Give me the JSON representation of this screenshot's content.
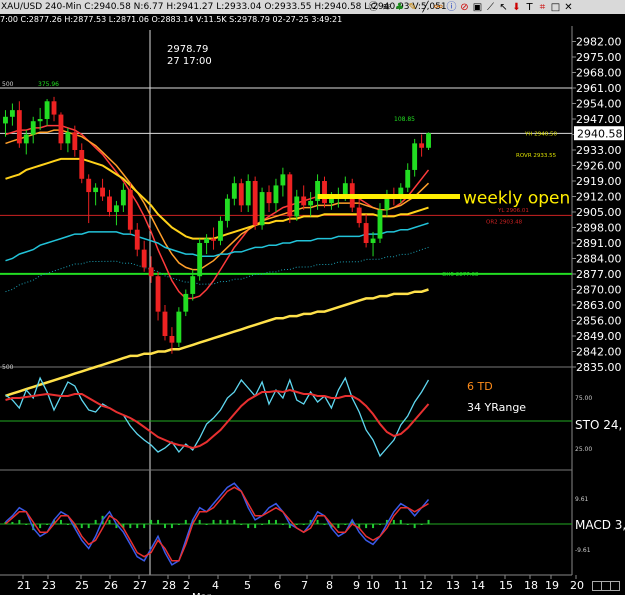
{
  "header": {
    "summary": "XAU/USD 240-Min C:2940.58 N:6.77 H:2941.27 L:2933.04 O:2933.55 H:2940.58 L:2940.93 V:5,051",
    "icons": [
      "c-icon",
      "wifi-icon",
      "tree-icon",
      "pencil-icon",
      "line-icon",
      "link-icon",
      "info-icon",
      "prohibit-icon",
      "lock-icon",
      "trend-icon",
      "pointer-icon",
      "arrow-down-icon",
      "t-icon",
      "chart-icon",
      "window-icon",
      "close-icon"
    ],
    "bar_info": "7:00 C:2877.26 H:2877.53 L:2871.06 O:2883.14 V:11.5K S:2978.79 02-27-25 3:49:21"
  },
  "crosshair_label": {
    "value": "2978.79",
    "time": "27 17:00"
  },
  "chart_data": [
    {
      "type": "candlestick",
      "panel": "price",
      "symbol": "XAU/USD",
      "interval": "240-Min",
      "ylim": [
        2835,
        2989
      ],
      "yticks": [
        "2982.00",
        "2975.00",
        "2968.00",
        "2961.00",
        "2954.00",
        "2947.00",
        "2940.00",
        "2933.00",
        "2926.00",
        "2919.00",
        "2912.00",
        "2905.00",
        "2898.00",
        "2891.00",
        "2884.00",
        "2877.00",
        "2870.00",
        "2863.00",
        "2856.00",
        "2849.00",
        "2842.00",
        "2835.00"
      ],
      "last_price": "2940.58",
      "left_labels": [
        "500",
        "500"
      ],
      "candles": [
        [
          2945,
          2951,
          2939,
          2948
        ],
        [
          2948,
          2954,
          2944,
          2951
        ],
        [
          2951,
          2955,
          2934,
          2936
        ],
        [
          2936,
          2942,
          2931,
          2940
        ],
        [
          2940,
          2948,
          2936,
          2946
        ],
        [
          2946,
          2952,
          2942,
          2947
        ],
        [
          2947,
          2956,
          2944,
          2955
        ],
        [
          2955,
          2957,
          2946,
          2949
        ],
        [
          2949,
          2950,
          2933,
          2936
        ],
        [
          2936,
          2943,
          2932,
          2941
        ],
        [
          2941,
          2944,
          2930,
          2933
        ],
        [
          2933,
          2936,
          2918,
          2920
        ],
        [
          2920,
          2922,
          2900,
          2914
        ],
        [
          2914,
          2918,
          2908,
          2916
        ],
        [
          2916,
          2920,
          2910,
          2912
        ],
        [
          2912,
          2915,
          2903,
          2905
        ],
        [
          2905,
          2910,
          2899,
          2908
        ],
        [
          2908,
          2918,
          2905,
          2915
        ],
        [
          2915,
          2918,
          2895,
          2897
        ],
        [
          2897,
          2900,
          2885,
          2888
        ],
        [
          2888,
          2892,
          2878,
          2880
        ],
        [
          2880,
          2885,
          2873,
          2876
        ],
        [
          2876,
          2878,
          2856,
          2860
        ],
        [
          2860,
          2863,
          2847,
          2849
        ],
        [
          2849,
          2853,
          2841,
          2846
        ],
        [
          2846,
          2862,
          2844,
          2860
        ],
        [
          2860,
          2870,
          2858,
          2868
        ],
        [
          2868,
          2879,
          2865,
          2876
        ],
        [
          2876,
          2893,
          2874,
          2891
        ],
        [
          2891,
          2895,
          2886,
          2893
        ],
        [
          2893,
          2898,
          2888,
          2892
        ],
        [
          2892,
          2903,
          2890,
          2901
        ],
        [
          2901,
          2913,
          2898,
          2911
        ],
        [
          2911,
          2921,
          2908,
          2918
        ],
        [
          2918,
          2920,
          2905,
          2908
        ],
        [
          2908,
          2922,
          2905,
          2919
        ],
        [
          2919,
          2921,
          2897,
          2899
        ],
        [
          2899,
          2916,
          2897,
          2914
        ],
        [
          2914,
          2917,
          2905,
          2909
        ],
        [
          2909,
          2920,
          2905,
          2917
        ],
        [
          2917,
          2925,
          2912,
          2922
        ],
        [
          2922,
          2923,
          2900,
          2903
        ],
        [
          2903,
          2915,
          2901,
          2912
        ],
        [
          2912,
          2917,
          2906,
          2908
        ],
        [
          2908,
          2914,
          2903,
          2910
        ],
        [
          2910,
          2922,
          2906,
          2919
        ],
        [
          2919,
          2921,
          2907,
          2909
        ],
        [
          2909,
          2914,
          2906,
          2911
        ],
        [
          2911,
          2916,
          2907,
          2913
        ],
        [
          2913,
          2921,
          2910,
          2918
        ],
        [
          2918,
          2920,
          2905,
          2907
        ],
        [
          2907,
          2911,
          2898,
          2900
        ],
        [
          2900,
          2904,
          2889,
          2891
        ],
        [
          2891,
          2896,
          2885,
          2893
        ],
        [
          2893,
          2909,
          2891,
          2906
        ],
        [
          2906,
          2915,
          2903,
          2913
        ],
        [
          2913,
          2916,
          2908,
          2911
        ],
        [
          2911,
          2918,
          2909,
          2916
        ],
        [
          2916,
          2927,
          2914,
          2924
        ],
        [
          2924,
          2938,
          2921,
          2936
        ],
        [
          2936,
          2940,
          2930,
          2934
        ],
        [
          2934,
          2941,
          2933,
          2940.58
        ]
      ],
      "moving_averages": [
        {
          "color": "#ff3b3b",
          "values": [
            2940,
            2941,
            2942,
            2942,
            2943,
            2943,
            2944,
            2944,
            2944,
            2943,
            2942,
            2940,
            2937,
            2934,
            2931,
            2927,
            2923,
            2919,
            2914,
            2909,
            2903,
            2896,
            2888,
            2881,
            2874,
            2869,
            2866,
            2866,
            2867,
            2870,
            2874,
            2879,
            2884,
            2889,
            2893,
            2897,
            2899,
            2901,
            2903,
            2905,
            2907,
            2908,
            2909,
            2910,
            2911,
            2912,
            2912,
            2912,
            2912,
            2913,
            2912,
            2911,
            2909,
            2907,
            2906,
            2906,
            2907,
            2909,
            2912,
            2916,
            2920,
            2924
          ]
        },
        {
          "color": "#ff9f2a",
          "values": [
            2936,
            2937,
            2938,
            2939,
            2940,
            2941,
            2941,
            2942,
            2942,
            2941,
            2940,
            2939,
            2937,
            2935,
            2932,
            2929,
            2926,
            2922,
            2918,
            2914,
            2909,
            2903,
            2897,
            2891,
            2886,
            2882,
            2880,
            2879,
            2879,
            2881,
            2883,
            2886,
            2889,
            2892,
            2895,
            2897,
            2899,
            2901,
            2902,
            2903,
            2904,
            2905,
            2906,
            2907,
            2907,
            2908,
            2908,
            2908,
            2909,
            2909,
            2909,
            2909,
            2908,
            2907,
            2906,
            2906,
            2907,
            2908,
            2910,
            2912,
            2915,
            2918
          ]
        },
        {
          "color": "#ffd21a",
          "values": [
            2920,
            2921,
            2922,
            2924,
            2925,
            2926,
            2927,
            2928,
            2929,
            2929,
            2929,
            2929,
            2928,
            2927,
            2926,
            2924,
            2922,
            2920,
            2917,
            2914,
            2911,
            2908,
            2904,
            2901,
            2898,
            2896,
            2894,
            2893,
            2893,
            2893,
            2893,
            2894,
            2895,
            2896,
            2897,
            2898,
            2899,
            2900,
            2900,
            2901,
            2901,
            2902,
            2902,
            2903,
            2903,
            2903,
            2904,
            2904,
            2904,
            2904,
            2904,
            2904,
            2904,
            2904,
            2903,
            2903,
            2903,
            2904,
            2904,
            2905,
            2906,
            2907
          ]
        },
        {
          "color": "#22c3d9",
          "values": [
            2883,
            2884,
            2886,
            2887,
            2888,
            2890,
            2891,
            2892,
            2893,
            2894,
            2895,
            2895,
            2896,
            2896,
            2896,
            2896,
            2896,
            2895,
            2895,
            2894,
            2893,
            2892,
            2891,
            2889,
            2888,
            2887,
            2886,
            2886,
            2885,
            2885,
            2885,
            2886,
            2886,
            2887,
            2887,
            2888,
            2889,
            2889,
            2890,
            2890,
            2891,
            2891,
            2892,
            2892,
            2892,
            2893,
            2893,
            2893,
            2894,
            2894,
            2894,
            2894,
            2895,
            2895,
            2895,
            2896,
            2896,
            2897,
            2897,
            2898,
            2899,
            2900
          ]
        },
        {
          "color": "#ffe14a",
          "values": [
            2822,
            2823,
            2824,
            2825,
            2826,
            2827,
            2828,
            2829,
            2830,
            2831,
            2832,
            2833,
            2834,
            2835,
            2836,
            2837,
            2838,
            2839,
            2840,
            2840,
            2841,
            2841,
            2842,
            2842,
            2843,
            2843,
            2844,
            2845,
            2846,
            2847,
            2848,
            2849,
            2850,
            2851,
            2852,
            2853,
            2854,
            2855,
            2856,
            2857,
            2857,
            2858,
            2858,
            2859,
            2859,
            2860,
            2860,
            2861,
            2862,
            2863,
            2864,
            2865,
            2866,
            2866,
            2867,
            2867,
            2868,
            2868,
            2868,
            2869,
            2869,
            2870
          ]
        }
      ],
      "levels": [
        {
          "label": "YH 2940.50",
          "value": 2940.5
        },
        {
          "label": "ROVR 2933.55",
          "value": 2933.55
        },
        {
          "label": "YL 2906.01",
          "value": 2906.01
        },
        {
          "label": "OR2 2903.48",
          "value": 2903.48
        },
        {
          "label": "OH5 2877.08",
          "value": 2877.08
        }
      ],
      "annotations": [
        {
          "text": "375.96"
        },
        {
          "text": "108.85"
        },
        {
          "text": "weekly open",
          "value": 2912
        }
      ]
    },
    {
      "type": "line",
      "panel": "stochastic",
      "title": "STO 24,",
      "yticks": [
        "75.00",
        "25.00"
      ],
      "labels": [
        "6 TD",
        "34 YRange"
      ],
      "series": [
        {
          "color": "#5fd7f0",
          "values": [
            75,
            70,
            62,
            80,
            72,
            92,
            78,
            60,
            74,
            88,
            84,
            70,
            60,
            58,
            66,
            62,
            58,
            55,
            44,
            36,
            30,
            25,
            18,
            22,
            28,
            18,
            26,
            20,
            32,
            46,
            52,
            60,
            72,
            78,
            90,
            82,
            74,
            88,
            66,
            80,
            72,
            90,
            70,
            66,
            78,
            68,
            74,
            62,
            80,
            92,
            72,
            58,
            40,
            30,
            14,
            22,
            30,
            45,
            54,
            68,
            78,
            90
          ]
        },
        {
          "color": "#e83030",
          "values": [
            70,
            72,
            72,
            73,
            74,
            75,
            76,
            75,
            74,
            74,
            76,
            76,
            72,
            68,
            64,
            62,
            58,
            55,
            52,
            48,
            43,
            38,
            33,
            30,
            27,
            25,
            24,
            22,
            24,
            28,
            34,
            40,
            48,
            56,
            64,
            70,
            74,
            78,
            78,
            79,
            78,
            80,
            78,
            76,
            76,
            74,
            74,
            72,
            72,
            74,
            74,
            70,
            64,
            56,
            46,
            38,
            34,
            36,
            42,
            50,
            58,
            66
          ]
        }
      ]
    },
    {
      "type": "line",
      "panel": "macd",
      "title": "MACD 3,",
      "yticks": [
        "9.61",
        "-9.61"
      ],
      "series": [
        {
          "color": "#3a5ae8",
          "values": [
            1,
            4,
            8,
            6,
            -2,
            -6,
            -4,
            2,
            6,
            4,
            -2,
            -8,
            -12,
            -6,
            2,
            6,
            0,
            -4,
            -10,
            -16,
            -18,
            -12,
            -6,
            -14,
            -20,
            -18,
            -8,
            2,
            8,
            6,
            10,
            14,
            18,
            20,
            16,
            8,
            2,
            4,
            8,
            10,
            6,
            0,
            -2,
            -4,
            0,
            6,
            4,
            -2,
            -6,
            -4,
            2,
            -4,
            -8,
            -10,
            -6,
            0,
            6,
            10,
            8,
            4,
            8,
            12
          ]
        },
        {
          "color": "#e83030",
          "values": [
            0,
            3,
            6,
            6,
            1,
            -4,
            -4,
            0,
            4,
            4,
            0,
            -6,
            -10,
            -8,
            -2,
            4,
            2,
            -2,
            -8,
            -14,
            -16,
            -14,
            -8,
            -12,
            -18,
            -18,
            -10,
            0,
            6,
            6,
            8,
            12,
            16,
            18,
            16,
            10,
            4,
            4,
            6,
            8,
            6,
            2,
            -2,
            -4,
            -2,
            4,
            4,
            0,
            -4,
            -4,
            0,
            -2,
            -6,
            -8,
            -6,
            -2,
            4,
            8,
            8,
            6,
            8,
            10
          ]
        },
        {
          "type": "bar",
          "color": "#22cc33",
          "values": [
            1,
            1,
            2,
            0,
            -3,
            -2,
            0,
            2,
            2,
            0,
            -2,
            -2,
            -2,
            2,
            4,
            2,
            -2,
            -2,
            -2,
            -2,
            -2,
            2,
            2,
            -2,
            -2,
            0,
            2,
            2,
            2,
            0,
            2,
            2,
            2,
            2,
            0,
            -2,
            -2,
            0,
            2,
            2,
            0,
            -2,
            0,
            0,
            2,
            2,
            0,
            -2,
            -2,
            0,
            2,
            -2,
            -2,
            -2,
            0,
            2,
            2,
            2,
            0,
            -2,
            0,
            2
          ]
        }
      ]
    }
  ],
  "x_axis": {
    "labels": [
      "21",
      "23",
      "25",
      "26",
      "27",
      "28",
      "2",
      "4",
      "5",
      "6",
      "7",
      "8",
      "9",
      "10",
      "11",
      "12",
      "13",
      "14",
      "15",
      "18",
      "19",
      "20"
    ],
    "bottom_partial": "Mar"
  }
}
